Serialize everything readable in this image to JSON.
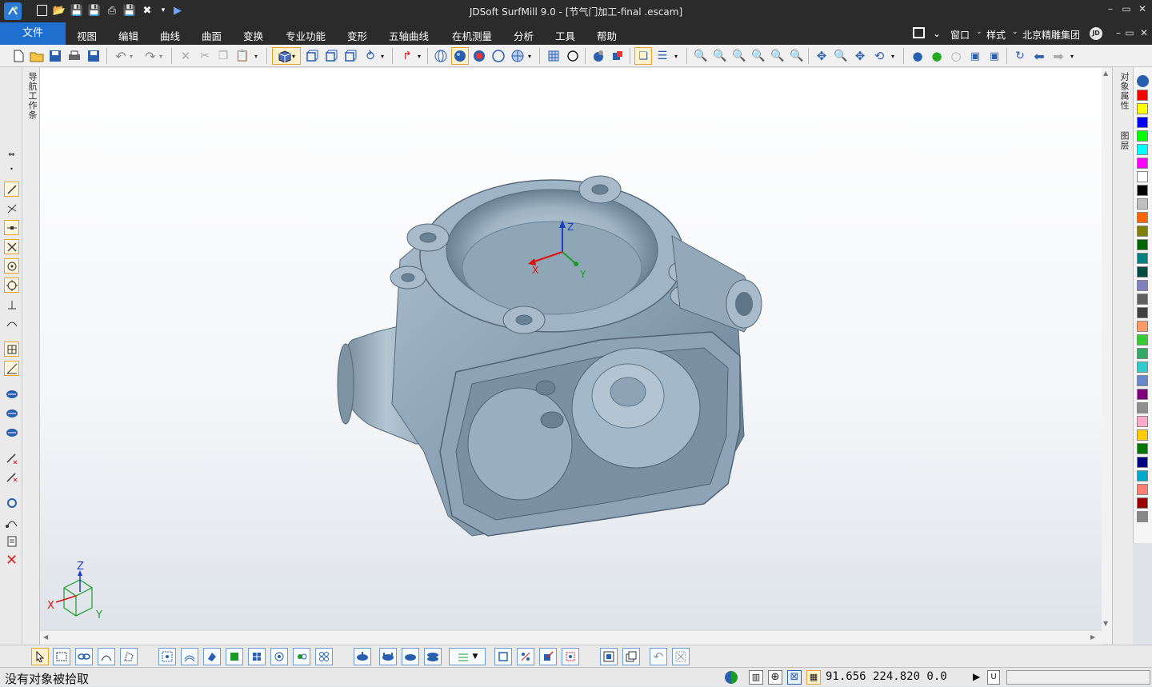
{
  "window": {
    "title": "JDSoft SurfMill 9.0 - [节气门加工-final .escam]",
    "controls": [
      "–",
      "▭",
      "✕"
    ]
  },
  "menu": {
    "file_tab": "文件",
    "items": [
      "视图",
      "编辑",
      "曲线",
      "曲面",
      "变换",
      "专业功能",
      "变形",
      "五轴曲线",
      "在机测量",
      "分析",
      "工具",
      "帮助"
    ],
    "right": {
      "window": "窗口",
      "style": "样式",
      "company": "北京精雕集团",
      "avatar": "JD"
    }
  },
  "left_panel": {
    "nav_tab": "导航工作条"
  },
  "right_panel": {
    "props_tab": "对象属性",
    "layers_tab": "图层"
  },
  "viewport": {
    "axis_labels": {
      "x": "X",
      "y": "Y",
      "z": "Z"
    },
    "model_color": "#8fa6b7"
  },
  "palette": {
    "colors": [
      "#ff0000",
      "#ffff00",
      "#0000ff",
      "#00ff00",
      "#00ffff",
      "#ff00ff",
      "#ffffff",
      "#000000",
      "#c0c0c0",
      "#ff6600",
      "#808000",
      "#006600",
      "#008080",
      "#004d40",
      "#8080c0",
      "#606060",
      "#404040",
      "#ff9966",
      "#33cc33",
      "#33aa66",
      "#33cccc",
      "#6688cc",
      "#800080",
      "#909090",
      "#ffaacc",
      "#ffcc00",
      "#007700",
      "#000080",
      "#00aacc",
      "#ff8070",
      "#990000",
      "#888888"
    ]
  },
  "status": {
    "message": "没有对象被拾取",
    "coordinates": "91.656  224.820  0.0",
    "u_button": "U"
  }
}
